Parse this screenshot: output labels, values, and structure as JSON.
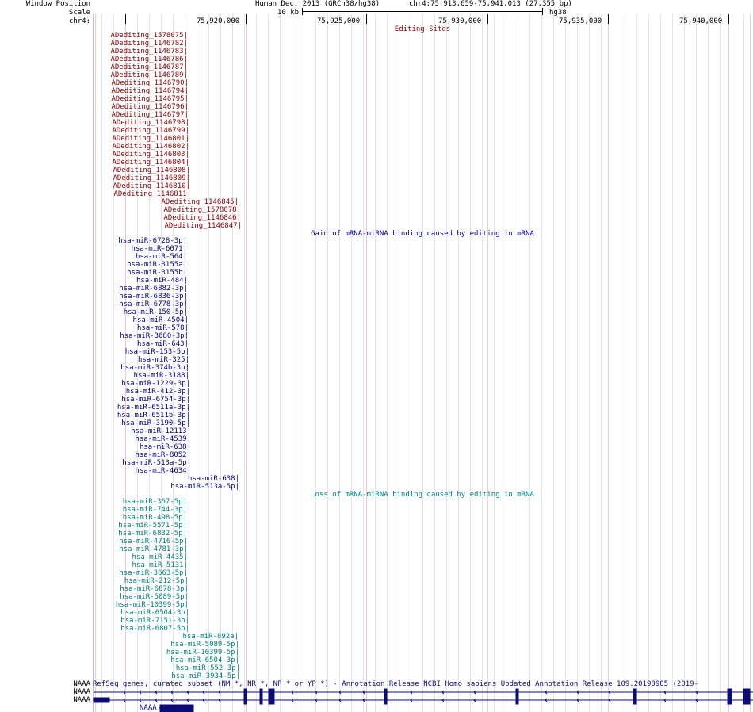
{
  "header": {
    "window_position_label": "Window Position",
    "scale_label": "Scale",
    "chrom_label": "chr4:",
    "assembly": "Human Dec. 2013 (GRCh38/hg38)",
    "position": "chr4:75,913,659-75,941,013 (27,355 bp)",
    "scale_text": "10 kb",
    "scale_db": "hg38",
    "ticks": [
      "75,920,000",
      "75,925,000",
      "75,930,000",
      "75,935,000",
      "75,940,000"
    ]
  },
  "tracks": {
    "editing_sites": {
      "title": "Editing Sites",
      "color": "#8b0000",
      "items": [
        "ADediting_1578075",
        "ADediting_1146782",
        "ADediting_1146783",
        "ADediting_1146786",
        "ADediting_1146787",
        "ADediting_1146789",
        "ADediting_1146790",
        "ADediting_1146794",
        "ADediting_1146795",
        "ADediting_1146796",
        "ADediting_1146797",
        "ADediting_1146798",
        "ADediting_1146799",
        "ADediting_1146801",
        "ADediting_1146802",
        "ADediting_1146803",
        "ADediting_1146804",
        "ADediting_1146808",
        "ADediting_1146809",
        "ADediting_1146810",
        "ADediting_1146811",
        "ADediting_1146845",
        "ADediting_1578078",
        "ADediting_1146846",
        "ADediting_1146847"
      ]
    },
    "gain": {
      "title": "Gain of mRNA-miRNA binding caused by editing in mRNA",
      "color": "#00008b",
      "items": [
        "hsa-miR-6728-3p",
        "hsa-miR-6071",
        "hsa-miR-564",
        "hsa-miR-3155a",
        "hsa-miR-3155b",
        "hsa-miR-484",
        "hsa-miR-6882-3p",
        "hsa-miR-6836-3p",
        "hsa-miR-6778-3p",
        "hsa-miR-150-5p",
        "hsa-miR-4504",
        "hsa-miR-578",
        "hsa-miR-3680-3p",
        "hsa-miR-643",
        "hsa-miR-153-5p",
        "hsa-miR-325",
        "hsa-miR-374b-3p",
        "hsa-miR-3188",
        "hsa-miR-1229-3p",
        "hsa-miR-412-3p",
        "hsa-miR-6754-3p",
        "hsa-miR-6511a-3p",
        "hsa-miR-6511b-3p",
        "hsa-miR-3190-5p",
        "hsa-miR-12113",
        "hsa-miR-4539",
        "hsa-miR-638",
        "hsa-miR-8052",
        "hsa-miR-513a-5p",
        "hsa-miR-4634",
        "hsa-miR-638",
        "hsa-miR-513a-5p"
      ]
    },
    "loss": {
      "title": "Loss of mRNA-miRNA binding caused by editing in mRNA",
      "color": "#008080",
      "items": [
        "hsa-miR-367-5p",
        "hsa-miR-744-3p",
        "hsa-miR-498-5p",
        "hsa-miR-5571-5p",
        "hsa-miR-6832-5p",
        "hsa-miR-4716-5p",
        "hsa-miR-4781-3p",
        "hsa-miR-4435",
        "hsa-miR-5131",
        "hsa-miR-3663-5p",
        "hsa-miR-212-5p",
        "hsa-miR-6878-3p",
        "hsa-miR-5089-5p",
        "hsa-miR-10399-5p",
        "hsa-miR-6504-3p",
        "hsa-miR-7151-3p",
        "hsa-miR-6807-5p",
        "hsa-miR-892a",
        "hsa-miR-5089-5p",
        "hsa-miR-10399-5p",
        "hsa-miR-6504-3p",
        "hsa-miR-552-3p",
        "hsa-miR-3934-5p"
      ]
    },
    "refseq": {
      "title": "RefSeq genes, curated subset (NM_*, NR_*, NP_* or YP_*) - Annotation Release NCBI Homo sapiens Updated Annotation Release 109.20190905 (2019-",
      "color": "#0c0c78",
      "gene_labels": [
        "NAAA",
        "NAAA",
        "NAAA"
      ]
    }
  }
}
